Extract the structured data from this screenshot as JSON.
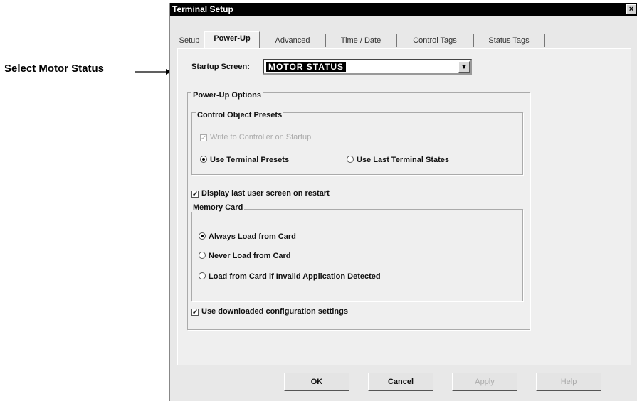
{
  "callout": {
    "text": "Select Motor Status"
  },
  "window": {
    "title": "Terminal Setup",
    "close_glyph": "×"
  },
  "tabs": [
    {
      "label": "Setup",
      "active": false
    },
    {
      "label": "Power-Up",
      "active": true
    },
    {
      "label": "Advanced",
      "active": false
    },
    {
      "label": "Time / Date",
      "active": false
    },
    {
      "label": "Control Tags",
      "active": false
    },
    {
      "label": "Status Tags",
      "active": false
    }
  ],
  "startup": {
    "label": "Startup Screen:",
    "value": "MOTOR STATUS",
    "dropdown_icon": "▼"
  },
  "power_up_options": {
    "title": "Power-Up Options",
    "control_presets": {
      "title": "Control Object Presets",
      "write_to_controller": {
        "label": "Write to Controller on Startup",
        "checked": true,
        "disabled": true
      },
      "use_terminal_presets": {
        "label": "Use Terminal Presets",
        "selected": true
      },
      "use_last_states": {
        "label": "Use Last Terminal States",
        "selected": false
      }
    },
    "display_last": {
      "label": "Display last user screen on restart",
      "checked": true
    },
    "memory_card": {
      "title": "Memory Card",
      "always_load": {
        "label": "Always Load from Card",
        "selected": true
      },
      "never_load": {
        "label": "Never Load from Card",
        "selected": false
      },
      "load_if_invalid": {
        "label": "Load from Card if Invalid Application Detected",
        "selected": false
      }
    },
    "use_downloaded": {
      "label": "Use downloaded configuration settings",
      "checked": true
    }
  },
  "buttons": {
    "ok": "OK",
    "cancel": "Cancel",
    "apply": "Apply",
    "help": "Help"
  },
  "check_glyph": "✓"
}
